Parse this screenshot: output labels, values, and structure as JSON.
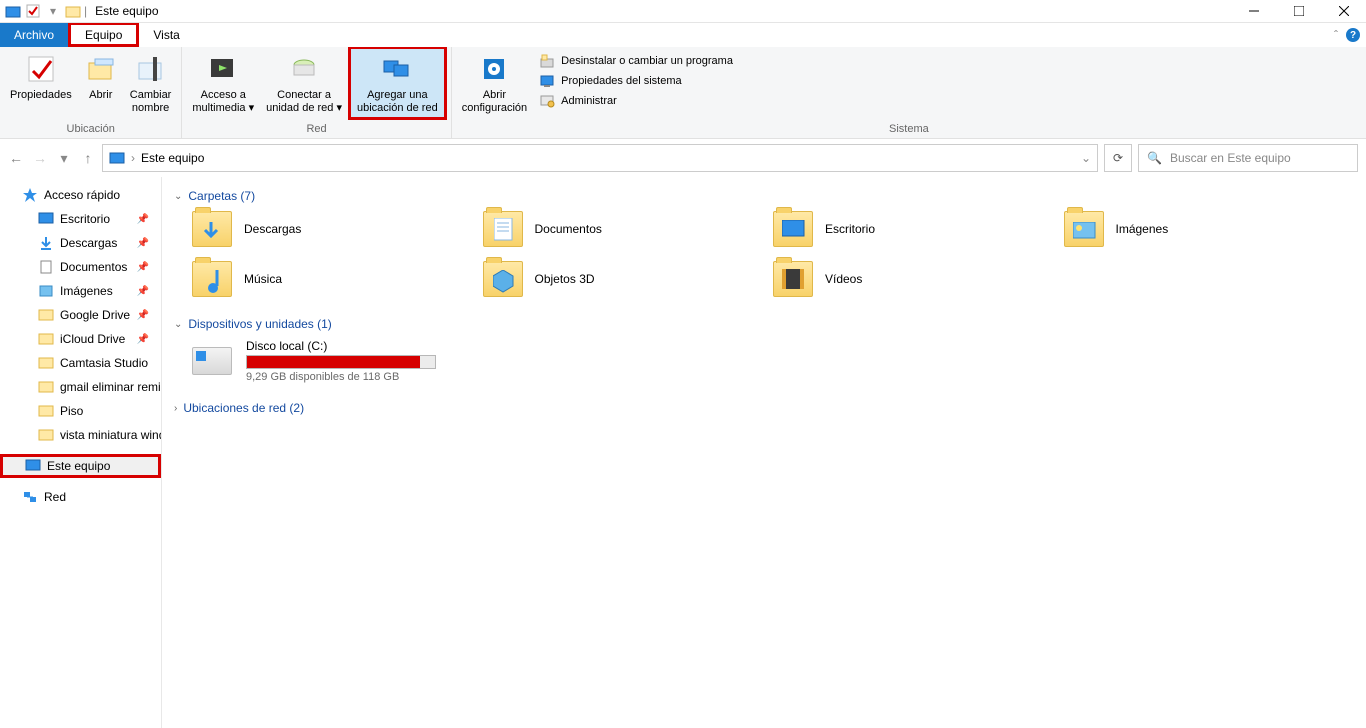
{
  "window": {
    "title": "Este equipo"
  },
  "tabs": {
    "archivo": "Archivo",
    "equipo": "Equipo",
    "vista": "Vista"
  },
  "ribbon": {
    "groups": {
      "ubicacion": {
        "label": "Ubicación",
        "propiedades": "Propiedades",
        "abrir": "Abrir",
        "cambiar_nombre_l1": "Cambiar",
        "cambiar_nombre_l2": "nombre"
      },
      "red": {
        "label": "Red",
        "acceso_l1": "Acceso a",
        "acceso_l2": "multimedia",
        "conectar_l1": "Conectar a",
        "conectar_l2": "unidad de red",
        "agregar_l1": "Agregar una",
        "agregar_l2": "ubicación de red"
      },
      "sistema": {
        "label": "Sistema",
        "abrir_cfg_l1": "Abrir",
        "abrir_cfg_l2": "configuración",
        "desinstalar": "Desinstalar o cambiar un programa",
        "prop_sistema": "Propiedades del sistema",
        "administrar": "Administrar"
      }
    }
  },
  "address": {
    "location": "Este equipo"
  },
  "search": {
    "placeholder": "Buscar en Este equipo"
  },
  "sidebar": {
    "quick_access": "Acceso rápido",
    "items": [
      {
        "label": "Escritorio",
        "pin": true
      },
      {
        "label": "Descargas",
        "pin": true
      },
      {
        "label": "Documentos",
        "pin": true
      },
      {
        "label": "Imágenes",
        "pin": true
      },
      {
        "label": "Google Drive",
        "pin": true
      },
      {
        "label": "iCloud Drive",
        "pin": true
      },
      {
        "label": "Camtasia Studio",
        "pin": false
      },
      {
        "label": "gmail eliminar remi",
        "pin": false
      },
      {
        "label": "Piso",
        "pin": false
      },
      {
        "label": "vista miniatura wind",
        "pin": false
      }
    ],
    "este_equipo": "Este equipo",
    "red": "Red"
  },
  "main": {
    "carpetas_header": "Carpetas (7)",
    "folders": [
      {
        "label": "Descargas"
      },
      {
        "label": "Documentos"
      },
      {
        "label": "Escritorio"
      },
      {
        "label": "Imágenes"
      },
      {
        "label": "Música"
      },
      {
        "label": "Objetos 3D"
      },
      {
        "label": "Vídeos"
      }
    ],
    "dispositivos_header": "Dispositivos y unidades (1)",
    "drive": {
      "name": "Disco local (C:)",
      "free_text": "9,29 GB disponibles de 118 GB",
      "fill_percent": 92
    },
    "ubicaciones_header": "Ubicaciones de red (2)"
  }
}
